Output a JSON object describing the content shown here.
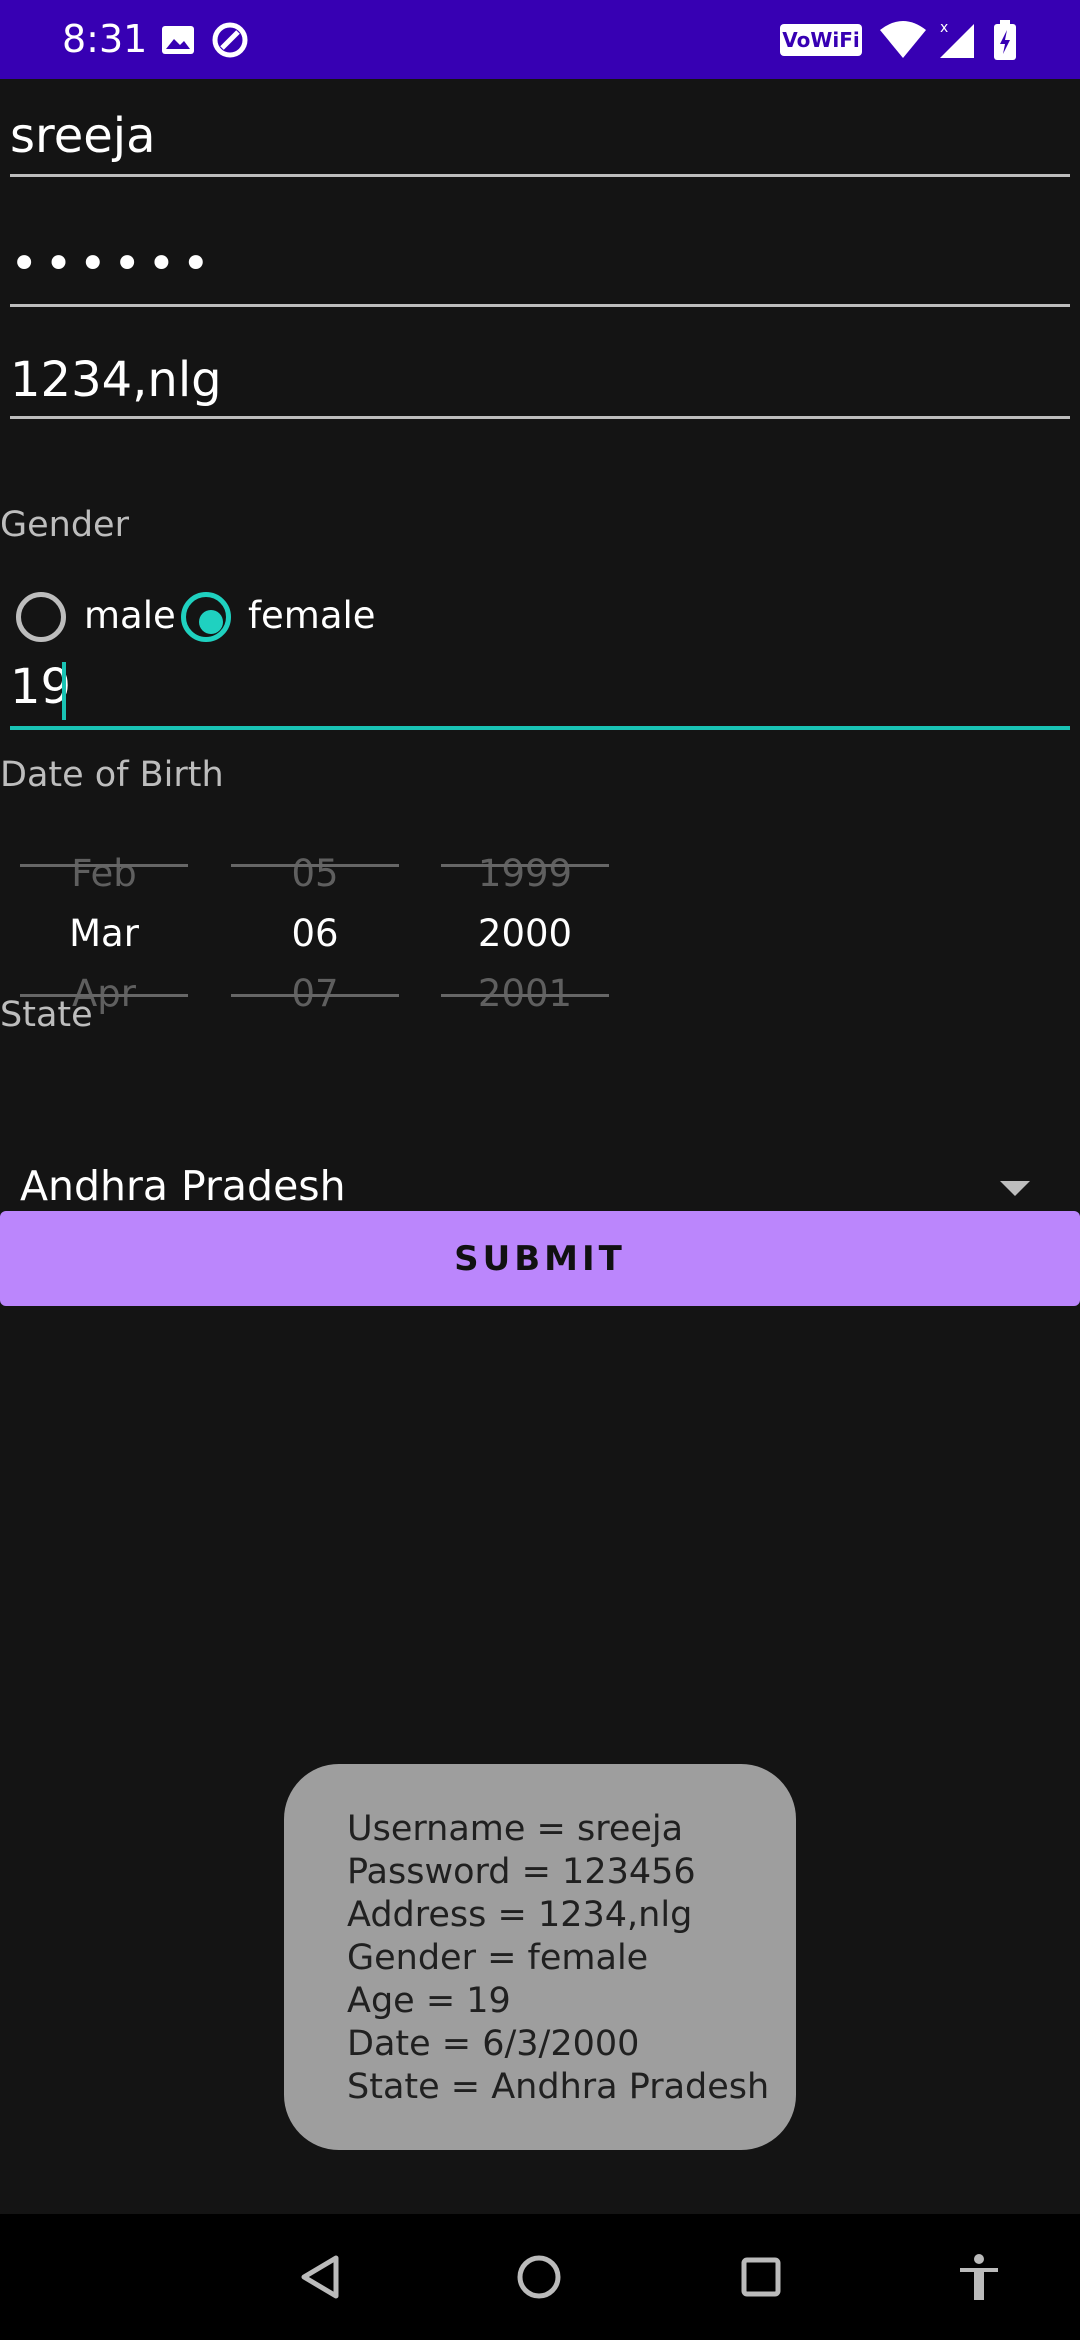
{
  "status_bar": {
    "time": "8:31",
    "vowifi": "VoWiFi",
    "icons": [
      "image-icon",
      "sync-icon",
      "wifi-icon",
      "signal-icon",
      "battery-icon"
    ]
  },
  "form": {
    "username": "sreeja",
    "password_mask": "••••••",
    "address": "1234,nlg",
    "gender_label": "Gender",
    "gender_options": [
      {
        "label": "male",
        "checked": false
      },
      {
        "label": "female",
        "checked": true
      }
    ],
    "age": "19",
    "dob_label": "Date of Birth",
    "date_picker": {
      "month": {
        "prev": "Feb",
        "selected": "Mar",
        "next": "Apr"
      },
      "day": {
        "prev": "05",
        "selected": "06",
        "next": "07"
      },
      "year": {
        "prev": "1999",
        "selected": "2000",
        "next": "2001"
      }
    },
    "state_label": "State",
    "state_value": "Andhra Pradesh",
    "submit_label": "SUBMIT"
  },
  "toast": {
    "lines": [
      "Username = sreeja",
      "Password = 123456",
      "Address = 1234,nlg",
      "Gender = female",
      "Age = 19",
      "Date = 6/3/2000",
      "State = Andhra Pradesh"
    ]
  },
  "colors": {
    "status_bar": "#3700b3",
    "background": "#141414",
    "accent": "#1fd1c0",
    "button": "#bb86fc",
    "toast": "#9e9e9e"
  },
  "nav_bar": {
    "icons": [
      "back-icon",
      "home-icon",
      "recents-icon",
      "accessibility-icon"
    ]
  }
}
